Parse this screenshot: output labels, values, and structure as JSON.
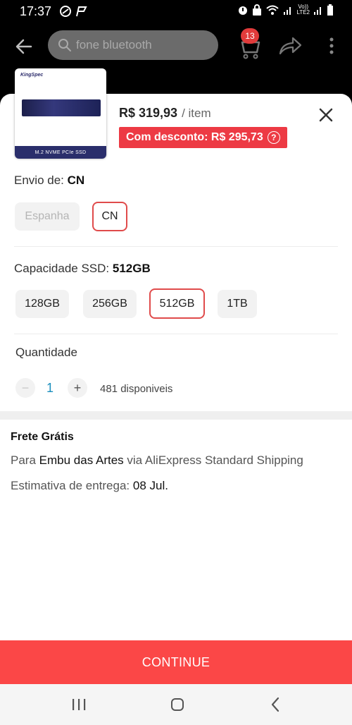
{
  "status_bar": {
    "time": "17:37",
    "network_label_top": "Vo))",
    "network_label_bottom": "LTE2"
  },
  "top_bar": {
    "search_text": "fone bluetooth",
    "cart_count": "13"
  },
  "product": {
    "thumb_brand": "KingSpec",
    "thumb_caption": "M.2 NVME PCIe SSD",
    "price": "R$ 319,93",
    "per_item": "/ item",
    "discount_label": "Com desconto: R$ 295,73",
    "discount_help_icon": "?"
  },
  "shipping_from": {
    "label": "Envio de:",
    "selected": "CN",
    "options": [
      "Espanha",
      "CN"
    ]
  },
  "capacity": {
    "label": "Capacidade SSD:",
    "selected": "512GB",
    "options": [
      "128GB",
      "256GB",
      "512GB",
      "1TB"
    ]
  },
  "quantity": {
    "label": "Quantidade",
    "minus": "−",
    "plus": "+",
    "value": "1",
    "stock": "481 disponiveis"
  },
  "shipping": {
    "title": "Frete Grátis",
    "to_prefix": "Para",
    "city": "Embu das Artes",
    "via": "via AliExpress Standard Shipping",
    "eta_prefix": "Estimativa de entrega:",
    "eta_date": "08 Jul."
  },
  "continue_label": "CONTINUE",
  "colors": {
    "accent_red": "#fb4747",
    "discount_red": "#ed3a44",
    "selected_border": "#e04b4b",
    "quantity_blue": "#1a8ebd"
  },
  "icons": [
    "back-arrow-icon",
    "search-icon",
    "cart-icon",
    "share-icon",
    "more-vert-icon",
    "close-icon",
    "help-circle-icon",
    "nav-recents-icon",
    "nav-home-icon",
    "nav-back-icon"
  ]
}
